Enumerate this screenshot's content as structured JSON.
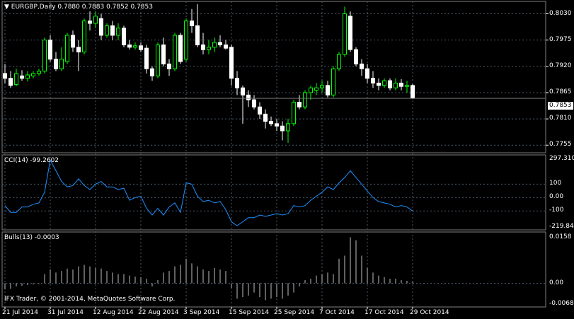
{
  "main_pane": {
    "symbol": "EURGBP",
    "timeframe": "Daily",
    "header": "EURGBP,Daily  0.7880 0.7883 0.7852 0.7853",
    "price_tag": "0.7853",
    "price_axis": [
      "0.8030",
      "0.7975",
      "0.7920",
      "0.7865",
      "0.7810",
      "0.7755"
    ]
  },
  "cci_pane": {
    "header": "CCI(14) -99.2602",
    "axis": [
      "297.3107",
      "100",
      "0.00",
      "-100",
      "-219.840"
    ]
  },
  "bulls_pane": {
    "header": "Bulls(13) -0.0003",
    "axis": [
      "0.0158",
      "0.00",
      "-0.0068"
    ]
  },
  "copyright": "IFX Trader, © 2001-2014, MetaQuotes Software Corp.",
  "time_axis": [
    "21 Jul 2014",
    "31 Jul 2014",
    "12 Aug 2014",
    "22 Aug 2014",
    "3 Sep 2014",
    "15 Sep 2014",
    "25 Sep 2014",
    "7 Oct 2014",
    "17 Oct 2014",
    "29 Oct 2014"
  ],
  "colors": {
    "up": "#00ff00",
    "down": "#ffffff",
    "cci_line": "#1e90ff",
    "bulls": "#c0c0c0",
    "grid": "#4a5a6a",
    "background": "#000000"
  },
  "chart_data": [
    {
      "type": "candlestick",
      "title": "EURGBP,Daily",
      "ylim": [
        0.7745,
        0.805
      ],
      "candles": [
        {
          "o": 0.7905,
          "h": 0.7925,
          "l": 0.7885,
          "c": 0.7895
        },
        {
          "o": 0.7895,
          "h": 0.791,
          "l": 0.7875,
          "c": 0.788
        },
        {
          "o": 0.7882,
          "h": 0.7915,
          "l": 0.7878,
          "c": 0.7905
        },
        {
          "o": 0.79,
          "h": 0.7912,
          "l": 0.789,
          "c": 0.7895
        },
        {
          "o": 0.7895,
          "h": 0.791,
          "l": 0.7888,
          "c": 0.7902
        },
        {
          "o": 0.79,
          "h": 0.791,
          "l": 0.7895,
          "c": 0.7905
        },
        {
          "o": 0.7905,
          "h": 0.7915,
          "l": 0.79,
          "c": 0.791
        },
        {
          "o": 0.791,
          "h": 0.798,
          "l": 0.7905,
          "c": 0.7975
        },
        {
          "o": 0.7975,
          "h": 0.7985,
          "l": 0.793,
          "c": 0.7935
        },
        {
          "o": 0.7935,
          "h": 0.795,
          "l": 0.791,
          "c": 0.7915
        },
        {
          "o": 0.7915,
          "h": 0.796,
          "l": 0.791,
          "c": 0.7935
        },
        {
          "o": 0.793,
          "h": 0.799,
          "l": 0.7925,
          "c": 0.7985
        },
        {
          "o": 0.7985,
          "h": 0.7995,
          "l": 0.795,
          "c": 0.796
        },
        {
          "o": 0.796,
          "h": 0.7975,
          "l": 0.791,
          "c": 0.795
        },
        {
          "o": 0.795,
          "h": 0.802,
          "l": 0.7945,
          "c": 0.8015
        },
        {
          "o": 0.8015,
          "h": 0.8035,
          "l": 0.7995,
          "c": 0.801
        },
        {
          "o": 0.801,
          "h": 0.8035,
          "l": 0.8,
          "c": 0.8025
        },
        {
          "o": 0.802,
          "h": 0.803,
          "l": 0.7975,
          "c": 0.7985
        },
        {
          "o": 0.7985,
          "h": 0.801,
          "l": 0.798,
          "c": 0.8005
        },
        {
          "o": 0.8005,
          "h": 0.8015,
          "l": 0.7975,
          "c": 0.7985
        },
        {
          "o": 0.7985,
          "h": 0.801,
          "l": 0.7975,
          "c": 0.8
        },
        {
          "o": 0.8,
          "h": 0.8005,
          "l": 0.796,
          "c": 0.7965
        },
        {
          "o": 0.7965,
          "h": 0.7975,
          "l": 0.7955,
          "c": 0.796
        },
        {
          "o": 0.796,
          "h": 0.797,
          "l": 0.7955,
          "c": 0.7963
        },
        {
          "o": 0.7963,
          "h": 0.797,
          "l": 0.795,
          "c": 0.7955
        },
        {
          "o": 0.7958,
          "h": 0.7965,
          "l": 0.7905,
          "c": 0.7915
        },
        {
          "o": 0.7915,
          "h": 0.792,
          "l": 0.789,
          "c": 0.79
        },
        {
          "o": 0.79,
          "h": 0.797,
          "l": 0.7895,
          "c": 0.7965
        },
        {
          "o": 0.7965,
          "h": 0.798,
          "l": 0.792,
          "c": 0.7925
        },
        {
          "o": 0.7925,
          "h": 0.7935,
          "l": 0.79,
          "c": 0.7915
        },
        {
          "o": 0.7915,
          "h": 0.799,
          "l": 0.791,
          "c": 0.7985
        },
        {
          "o": 0.7985,
          "h": 0.799,
          "l": 0.7925,
          "c": 0.793
        },
        {
          "o": 0.7935,
          "h": 0.802,
          "l": 0.793,
          "c": 0.8015
        },
        {
          "o": 0.8015,
          "h": 0.804,
          "l": 0.799,
          "c": 0.8005
        },
        {
          "o": 0.8005,
          "h": 0.805,
          "l": 0.796,
          "c": 0.7965
        },
        {
          "o": 0.7965,
          "h": 0.799,
          "l": 0.7945,
          "c": 0.7955
        },
        {
          "o": 0.7955,
          "h": 0.7975,
          "l": 0.7945,
          "c": 0.796
        },
        {
          "o": 0.796,
          "h": 0.798,
          "l": 0.795,
          "c": 0.797
        },
        {
          "o": 0.797,
          "h": 0.7985,
          "l": 0.796,
          "c": 0.7965
        },
        {
          "o": 0.7965,
          "h": 0.7975,
          "l": 0.7955,
          "c": 0.7958
        },
        {
          "o": 0.796,
          "h": 0.7965,
          "l": 0.788,
          "c": 0.7895
        },
        {
          "o": 0.7895,
          "h": 0.791,
          "l": 0.786,
          "c": 0.7875
        },
        {
          "o": 0.7875,
          "h": 0.788,
          "l": 0.78,
          "c": 0.786
        },
        {
          "o": 0.786,
          "h": 0.787,
          "l": 0.7835,
          "c": 0.785
        },
        {
          "o": 0.785,
          "h": 0.786,
          "l": 0.783,
          "c": 0.7835
        },
        {
          "o": 0.7835,
          "h": 0.7845,
          "l": 0.781,
          "c": 0.782
        },
        {
          "o": 0.782,
          "h": 0.783,
          "l": 0.779,
          "c": 0.7805
        },
        {
          "o": 0.7805,
          "h": 0.7815,
          "l": 0.7795,
          "c": 0.78
        },
        {
          "o": 0.78,
          "h": 0.781,
          "l": 0.7785,
          "c": 0.7795
        },
        {
          "o": 0.7795,
          "h": 0.7805,
          "l": 0.7765,
          "c": 0.7785
        },
        {
          "o": 0.7785,
          "h": 0.781,
          "l": 0.776,
          "c": 0.78
        },
        {
          "o": 0.78,
          "h": 0.785,
          "l": 0.7795,
          "c": 0.7845
        },
        {
          "o": 0.7845,
          "h": 0.786,
          "l": 0.783,
          "c": 0.7835
        },
        {
          "o": 0.7835,
          "h": 0.787,
          "l": 0.783,
          "c": 0.7865
        },
        {
          "o": 0.7865,
          "h": 0.788,
          "l": 0.785,
          "c": 0.7875
        },
        {
          "o": 0.787,
          "h": 0.7885,
          "l": 0.786,
          "c": 0.7875
        },
        {
          "o": 0.7875,
          "h": 0.789,
          "l": 0.7865,
          "c": 0.788
        },
        {
          "o": 0.788,
          "h": 0.789,
          "l": 0.7855,
          "c": 0.786
        },
        {
          "o": 0.786,
          "h": 0.792,
          "l": 0.7855,
          "c": 0.7915
        },
        {
          "o": 0.7915,
          "h": 0.795,
          "l": 0.791,
          "c": 0.7945
        },
        {
          "o": 0.7945,
          "h": 0.8045,
          "l": 0.794,
          "c": 0.803
        },
        {
          "o": 0.8025,
          "h": 0.8035,
          "l": 0.795,
          "c": 0.7955
        },
        {
          "o": 0.7955,
          "h": 0.796,
          "l": 0.792,
          "c": 0.7925
        },
        {
          "o": 0.7925,
          "h": 0.7935,
          "l": 0.79,
          "c": 0.7915
        },
        {
          "o": 0.7915,
          "h": 0.7925,
          "l": 0.7885,
          "c": 0.7895
        },
        {
          "o": 0.7895,
          "h": 0.791,
          "l": 0.7875,
          "c": 0.7885
        },
        {
          "o": 0.7885,
          "h": 0.7895,
          "l": 0.787,
          "c": 0.788
        },
        {
          "o": 0.788,
          "h": 0.7895,
          "l": 0.7875,
          "c": 0.789
        },
        {
          "o": 0.789,
          "h": 0.7895,
          "l": 0.787,
          "c": 0.7875
        },
        {
          "o": 0.7875,
          "h": 0.7895,
          "l": 0.787,
          "c": 0.7885
        },
        {
          "o": 0.7885,
          "h": 0.7893,
          "l": 0.787,
          "c": 0.7878
        },
        {
          "o": 0.7878,
          "h": 0.789,
          "l": 0.7865,
          "c": 0.788
        },
        {
          "o": 0.788,
          "h": 0.7883,
          "l": 0.7852,
          "c": 0.7853
        }
      ]
    },
    {
      "type": "line",
      "title": "CCI(14) -99.2602",
      "ylim": [
        -219.84,
        297.3107
      ],
      "series": [
        {
          "name": "CCI(14)",
          "values": [
            -60,
            -110,
            -110,
            -70,
            -70,
            -50,
            -40,
            40,
            280,
            200,
            120,
            80,
            90,
            140,
            90,
            60,
            100,
            120,
            80,
            80,
            60,
            70,
            -20,
            0,
            10,
            -80,
            -130,
            -80,
            -130,
            -70,
            -40,
            -110,
            110,
            100,
            10,
            -30,
            -20,
            -40,
            -30,
            -90,
            -180,
            -210,
            -180,
            -150,
            -150,
            -130,
            -140,
            -130,
            -120,
            -130,
            -120,
            -60,
            -70,
            -60,
            -20,
            10,
            40,
            80,
            60,
            110,
            150,
            200,
            150,
            100,
            50,
            0,
            -30,
            -40,
            -50,
            -70,
            -60,
            -70,
            -100
          ]
        }
      ]
    },
    {
      "type": "bar",
      "title": "Bulls(13) -0.0003",
      "ylim": [
        -0.0068,
        0.0158
      ],
      "series": [
        {
          "name": "Bulls(13)",
          "values": [
            -0.002,
            -0.0018,
            -0.001,
            -0.0008,
            -0.0006,
            -0.0004,
            -0.0002,
            0.003,
            0.0045,
            0.0035,
            0.004,
            0.0048,
            0.0045,
            0.0055,
            0.006,
            0.0055,
            0.005,
            0.0048,
            0.004,
            0.0035,
            0.003,
            0.003,
            0.0025,
            0.0022,
            0.002,
            0.0015,
            -0.001,
            0.001,
            0.0035,
            0.004,
            0.0055,
            0.006,
            0.008,
            0.0065,
            0.0055,
            0.0045,
            0.004,
            0.005,
            0.0045,
            0.004,
            -0.0015,
            -0.005,
            -0.0045,
            -0.004,
            -0.003,
            -0.0045,
            -0.0055,
            -0.005,
            -0.0045,
            -0.005,
            -0.004,
            -0.003,
            -0.001,
            0.001,
            0.0015,
            0.0025,
            0.003,
            0.0035,
            0.003,
            0.008,
            0.009,
            0.015,
            0.014,
            0.009,
            0.005,
            0.0035,
            0.0025,
            0.002,
            0.0015,
            0.0015,
            0.001,
            0.0008,
            0.0005
          ]
        }
      ]
    }
  ]
}
